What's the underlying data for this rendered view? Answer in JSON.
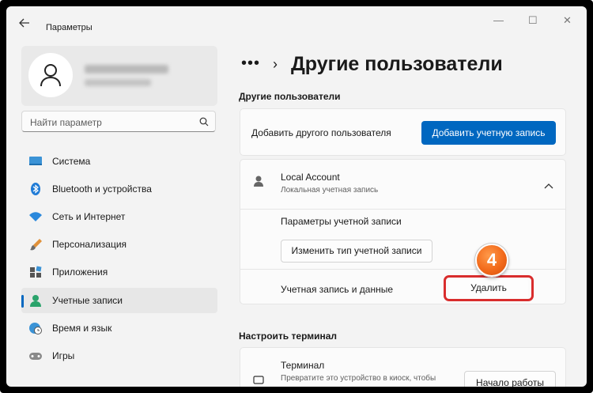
{
  "app": {
    "title": "Параметры",
    "back_icon": "back-arrow-icon"
  },
  "window_controls": {
    "minimize": "—",
    "maximize": "☐",
    "close": "✕"
  },
  "sidebar": {
    "search_placeholder": "Найти параметр",
    "items": [
      {
        "label": "Система",
        "icon": "display-icon"
      },
      {
        "label": "Bluetooth и устройства",
        "icon": "bluetooth-icon"
      },
      {
        "label": "Сеть и Интернет",
        "icon": "wifi-icon"
      },
      {
        "label": "Персонализация",
        "icon": "brush-icon"
      },
      {
        "label": "Приложения",
        "icon": "apps-icon"
      },
      {
        "label": "Учетные записи",
        "icon": "account-icon",
        "active": true
      },
      {
        "label": "Время и язык",
        "icon": "globe-clock-icon"
      },
      {
        "label": "Игры",
        "icon": "gamepad-icon"
      }
    ]
  },
  "main": {
    "breadcrumb_dots": "•••",
    "breadcrumb_sep": "›",
    "title": "Другие пользователи",
    "section1_title": "Другие пользователи",
    "add_user_label": "Добавить другого пользователя",
    "add_account_button": "Добавить учетную запись",
    "account": {
      "name": "Local Account",
      "type": "Локальная учетная запись",
      "options_label": "Параметры учетной записи",
      "change_type_button": "Изменить тип учетной записи",
      "data_label": "Учетная запись и данные",
      "delete_button": "Удалить"
    },
    "section2_title": "Настроить терминал",
    "kiosk": {
      "title": "Терминал",
      "description": "Превратите это устройство в киоск, чтобы",
      "start_button": "Начало работы"
    }
  },
  "annotation": {
    "step_number": "4",
    "accent": "#f26a1b",
    "highlight": "#d92d2d"
  },
  "colors": {
    "accent": "#0067c0",
    "background": "#f3f3f3",
    "card": "#fbfbfb"
  }
}
